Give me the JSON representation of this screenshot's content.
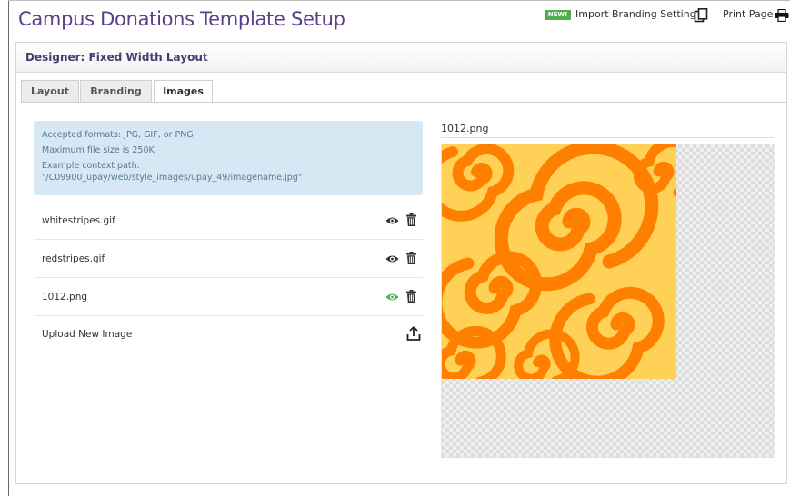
{
  "page": {
    "title": "Campus Donations Template Setup"
  },
  "top_actions": {
    "new_badge": "NEW!",
    "import_label": "Import Branding Settings",
    "print_label": "Print Page"
  },
  "designer": {
    "title": "Designer: Fixed Width Layout"
  },
  "tabs": [
    {
      "label": "Layout",
      "active": false
    },
    {
      "label": "Branding",
      "active": false
    },
    {
      "label": "Images",
      "active": true
    }
  ],
  "info": {
    "lines": [
      "Accepted formats: JPG, GIF, or PNG",
      "Maximum file size is 250K",
      "Example context path:",
      "\"/C09900_upay/web/style_images/upay_49/imagename.jpg\""
    ]
  },
  "images": [
    {
      "name": "whitestripes.gif",
      "previewing": false,
      "eye_icon": "eye-icon",
      "delete_icon": "trash-icon"
    },
    {
      "name": "redstripes.gif",
      "previewing": false,
      "eye_icon": "eye-icon",
      "delete_icon": "trash-icon"
    },
    {
      "name": "1012.png",
      "previewing": true,
      "eye_icon": "eye-icon",
      "delete_icon": "trash-icon"
    }
  ],
  "upload": {
    "label": "Upload New Image",
    "icon": "upload-icon"
  },
  "preview": {
    "title": "1012.png"
  },
  "colors": {
    "title_purple": "#5a3e86",
    "badge_green": "#4cae4c",
    "eye_active": "#4cae4c",
    "eye_default": "#333333",
    "info_bg": "#d5e8f3",
    "swirl_orange": "#ff7f00",
    "swirl_yellow": "#ffd257"
  }
}
